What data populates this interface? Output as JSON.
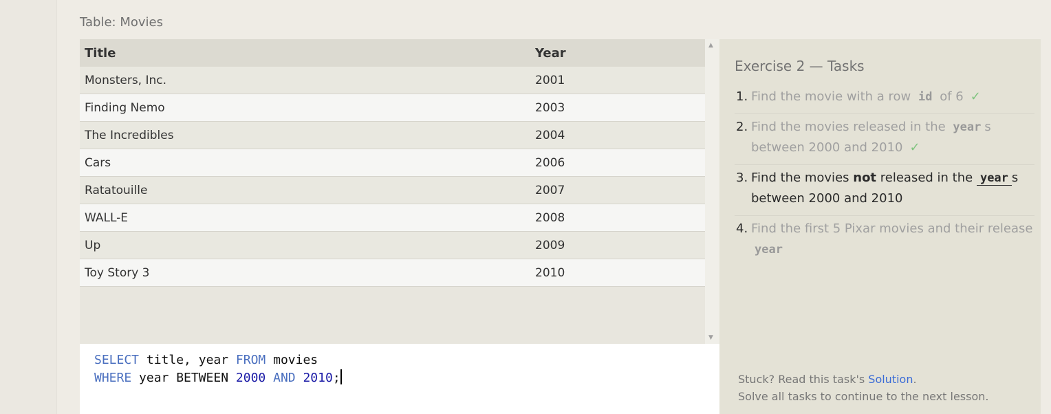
{
  "table_caption": "Table: Movies",
  "columns": [
    "Title",
    "Year"
  ],
  "rows": [
    {
      "title": "Monsters, Inc.",
      "year": "2001"
    },
    {
      "title": "Finding Nemo",
      "year": "2003"
    },
    {
      "title": "The Incredibles",
      "year": "2004"
    },
    {
      "title": "Cars",
      "year": "2006"
    },
    {
      "title": "Ratatouille",
      "year": "2007"
    },
    {
      "title": "WALL-E",
      "year": "2008"
    },
    {
      "title": "Up",
      "year": "2009"
    },
    {
      "title": "Toy Story 3",
      "year": "2010"
    }
  ],
  "query": {
    "line1": {
      "kw1": "SELECT",
      "t1": " title, year ",
      "kw2": "FROM",
      "t2": " movies"
    },
    "line2": {
      "kw1": "WHERE",
      "t1": " year BETWEEN ",
      "n1": "2000",
      "kw2": "AND",
      "n2": "2010",
      "t2": ";"
    }
  },
  "tasks_title": "Exercise 2 — Tasks",
  "tasks": [
    {
      "num": "1.",
      "pre": "Find the movie with a row ",
      "code": "id",
      "post": " of 6",
      "check": "✓"
    },
    {
      "num": "2.",
      "pre": "Find the movies released in the ",
      "code": "year",
      "post": "s between 2000 and 2010",
      "check": "✓"
    },
    {
      "num": "3.",
      "pre": "Find the movies ",
      "bold": "not",
      "mid": " released in the ",
      "code": "year",
      "post": "s between 2000 and 2010"
    },
    {
      "num": "4.",
      "pre": "Find the first 5 Pixar movies and their release ",
      "code": "year"
    }
  ],
  "help": {
    "pre": "Stuck? Read this task's ",
    "link": "Solution",
    "post": ".",
    "line2": "Solve all tasks to continue to the next lesson."
  },
  "icons": {
    "scroll_up": "triangle-up",
    "scroll_down": "triangle-down"
  },
  "colors": {
    "keyword": "#4a6fbf",
    "number": "#1a1aa6",
    "check": "#7fc47f",
    "link": "#3b6cd6"
  }
}
